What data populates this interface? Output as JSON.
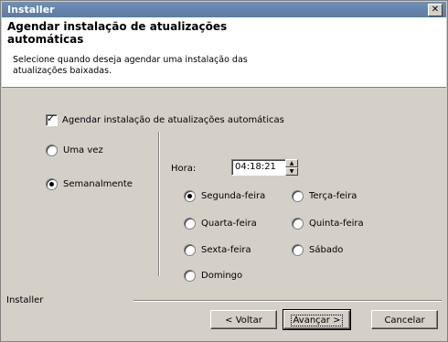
{
  "window": {
    "title": "Installer",
    "close_glyph": "✕"
  },
  "header": {
    "title": "Agendar instalação de atualizações automáticas",
    "subtitle": "Selecione quando deseja agendar uma instalação das atualizações baixadas."
  },
  "schedule_checkbox": {
    "label": "Agendar instalação de atualizações automáticas",
    "checked": true
  },
  "frequency": {
    "options": [
      {
        "label": "Uma vez",
        "selected": false
      },
      {
        "label": "Semanalmente",
        "selected": true
      }
    ]
  },
  "time": {
    "label": "Hora:",
    "value": "04:18:21"
  },
  "days": [
    {
      "label": "Segunda-feira",
      "selected": true
    },
    {
      "label": "Terça-feira",
      "selected": false
    },
    {
      "label": "Quarta-feira",
      "selected": false
    },
    {
      "label": "Quinta-feira",
      "selected": false
    },
    {
      "label": "Sexta-feira",
      "selected": false
    },
    {
      "label": "Sábado",
      "selected": false
    },
    {
      "label": "Domingo",
      "selected": false
    }
  ],
  "footer": {
    "label": "Installer"
  },
  "buttons": {
    "back": "< Voltar",
    "next": "Avançar >",
    "cancel": "Cancelar"
  }
}
